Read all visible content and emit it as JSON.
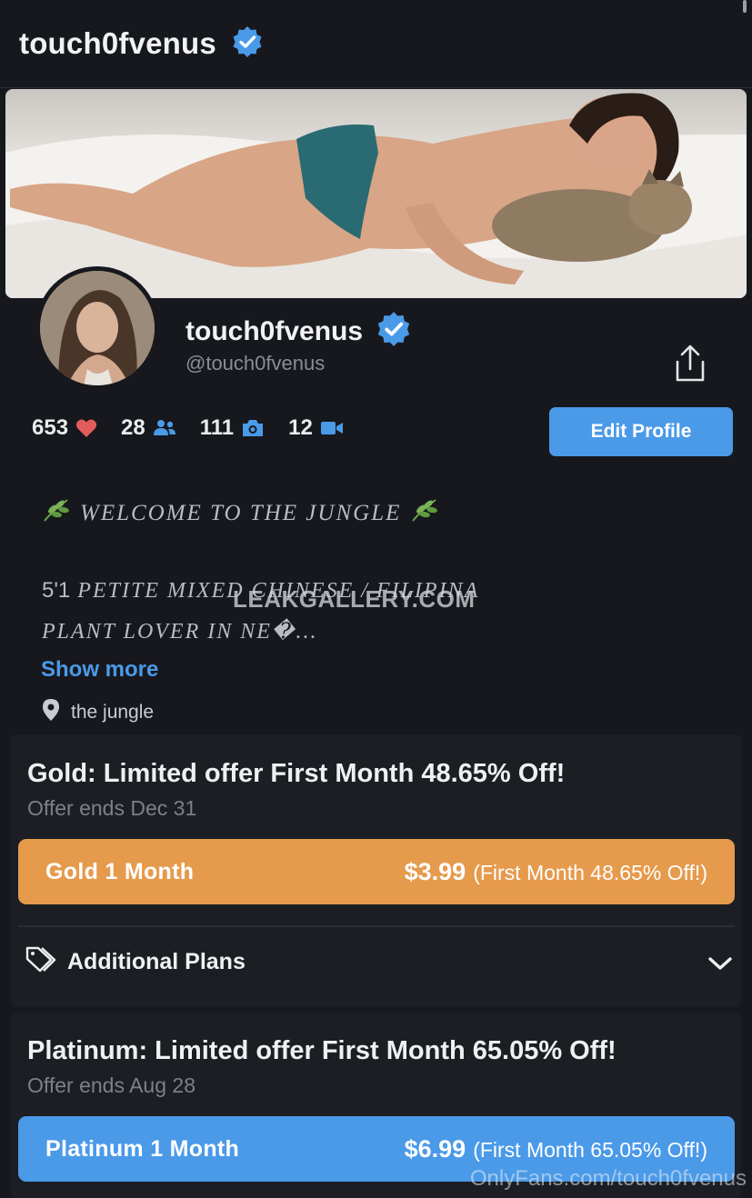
{
  "header": {
    "title": "touch0fvenus",
    "verified_icon": "verified-badge-icon"
  },
  "profile": {
    "name": "touch0fvenus",
    "handle": "@touch0fvenus",
    "edit_label": "Edit Profile"
  },
  "stats": [
    {
      "value": "653",
      "icon": "heart-icon"
    },
    {
      "value": "28",
      "icon": "fans-icon"
    },
    {
      "value": "111",
      "icon": "camera-icon"
    },
    {
      "value": "12",
      "icon": "video-icon"
    }
  ],
  "bio": {
    "welcome": "WELCOME TO THE JUNGLE",
    "line2_height": "5'1",
    "line2_rest": "PETITE MIXED CHINESE / FILIPINA",
    "line3": "PLANT LOVER IN NE�...",
    "show_more": "Show more",
    "location": "the jungle"
  },
  "watermark": "LEAKGALLERY.COM",
  "gold": {
    "title": "Gold: Limited offer First Month 48.65% Off!",
    "ends": "Offer ends Dec 31",
    "plan_name": "Gold 1 Month",
    "price": "$3.99",
    "paren_open": "(",
    "discount": "First Month 48.65% Off!",
    "paren_close": ")"
  },
  "additional_plans": {
    "label": "Additional Plans"
  },
  "platinum": {
    "title": "Platinum: Limited offer First Month 65.05% Off!",
    "ends": "Offer ends Aug 28",
    "plan_name": "Platinum 1 Month",
    "price": "$6.99",
    "paren_open": "(",
    "discount": "First Month 65.05% Off!",
    "paren_close": ")"
  },
  "footer_watermark": "OnlyFans.com/touch0fvenus",
  "colors": {
    "background": "#16181d",
    "accent_blue": "#4a9ae8",
    "gold": "#e69a4c",
    "heart": "#e25c5c"
  }
}
